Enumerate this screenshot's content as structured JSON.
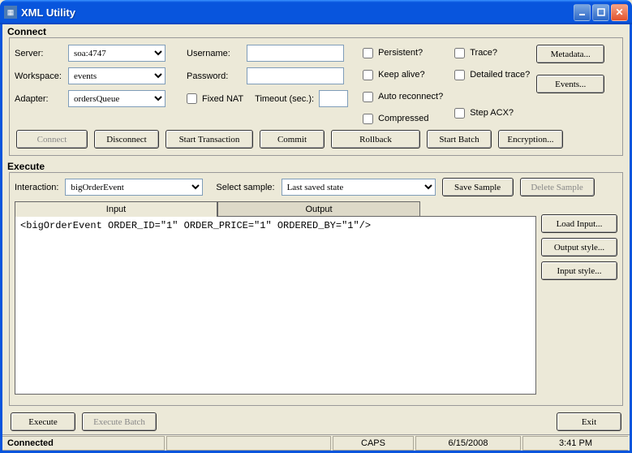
{
  "window": {
    "title": "XML Utility"
  },
  "connect": {
    "legend": "Connect",
    "server_label": "Server:",
    "server_value": "soa:4747",
    "workspace_label": "Workspace:",
    "workspace_value": "events",
    "adapter_label": "Adapter:",
    "adapter_value": "ordersQueue",
    "username_label": "Username:",
    "username_value": "",
    "password_label": "Password:",
    "password_value": "",
    "fixed_nat_label": "Fixed NAT",
    "timeout_label": "Timeout (sec.):",
    "timeout_value": "",
    "persistent_label": "Persistent?",
    "keepalive_label": "Keep alive?",
    "autoreconnect_label": "Auto reconnect?",
    "compressed_label": "Compressed",
    "trace_label": "Trace?",
    "detailed_trace_label": "Detailed trace?",
    "step_acx_label": "Step ACX?",
    "metadata_btn": "Metadata...",
    "events_btn": "Events...",
    "connect_btn": "Connect",
    "disconnect_btn": "Disconnect",
    "start_tx_btn": "Start Transaction",
    "commit_btn": "Commit",
    "rollback_btn": "Rollback",
    "start_batch_btn": "Start Batch",
    "encryption_btn": "Encryption..."
  },
  "execute": {
    "legend": "Execute",
    "interaction_label": "Interaction:",
    "interaction_value": "bigOrderEvent",
    "select_sample_label": "Select sample:",
    "select_sample_value": "Last saved state",
    "save_sample_btn": "Save Sample",
    "delete_sample_btn": "Delete Sample",
    "tab_input": "Input",
    "tab_output": "Output",
    "xml_content": "<bigOrderEvent ORDER_ID=\"1\" ORDER_PRICE=\"1\" ORDERED_BY=\"1\"/>",
    "load_input_btn": "Load Input...",
    "output_style_btn": "Output style...",
    "input_style_btn": "Input style...",
    "execute_btn": "Execute",
    "execute_batch_btn": "Execute Batch",
    "exit_btn": "Exit"
  },
  "status": {
    "connected": "Connected",
    "caps": "CAPS",
    "date": "6/15/2008",
    "time": "3:41 PM"
  }
}
